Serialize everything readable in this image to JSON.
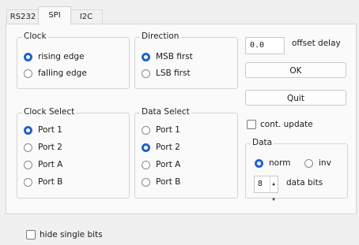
{
  "tabs": [
    "RS232",
    "SPI",
    "I2C"
  ],
  "clock": {
    "title": "Clock",
    "options": [
      "rising edge",
      "falling edge"
    ],
    "selected": 0
  },
  "direction": {
    "title": "Direction",
    "options": [
      "MSB first",
      "LSB first"
    ],
    "selected": 0
  },
  "clock_select": {
    "title": "Clock Select",
    "options": [
      "Port 1",
      "Port 2",
      "Port A",
      "Port B"
    ],
    "selected": 0
  },
  "data_select": {
    "title": "Data Select",
    "options": [
      "Port 1",
      "Port 2",
      "Port A",
      "Port B"
    ],
    "selected": 1
  },
  "offset": {
    "value": "0.0",
    "label": "offset delay"
  },
  "buttons": {
    "ok": "OK",
    "quit": "Quit"
  },
  "cont_update": {
    "label": "cont. update",
    "checked": false
  },
  "data": {
    "title": "Data",
    "options": [
      "norm",
      "inv"
    ],
    "selected": 0,
    "bits_value": "8",
    "bits_label": "data bits"
  },
  "hide_single_bits": {
    "label": "hide single bits",
    "checked": false
  },
  "colors": {
    "accent": "#1f63c9",
    "panel": "#fafafa",
    "window": "#f0f0f0"
  }
}
